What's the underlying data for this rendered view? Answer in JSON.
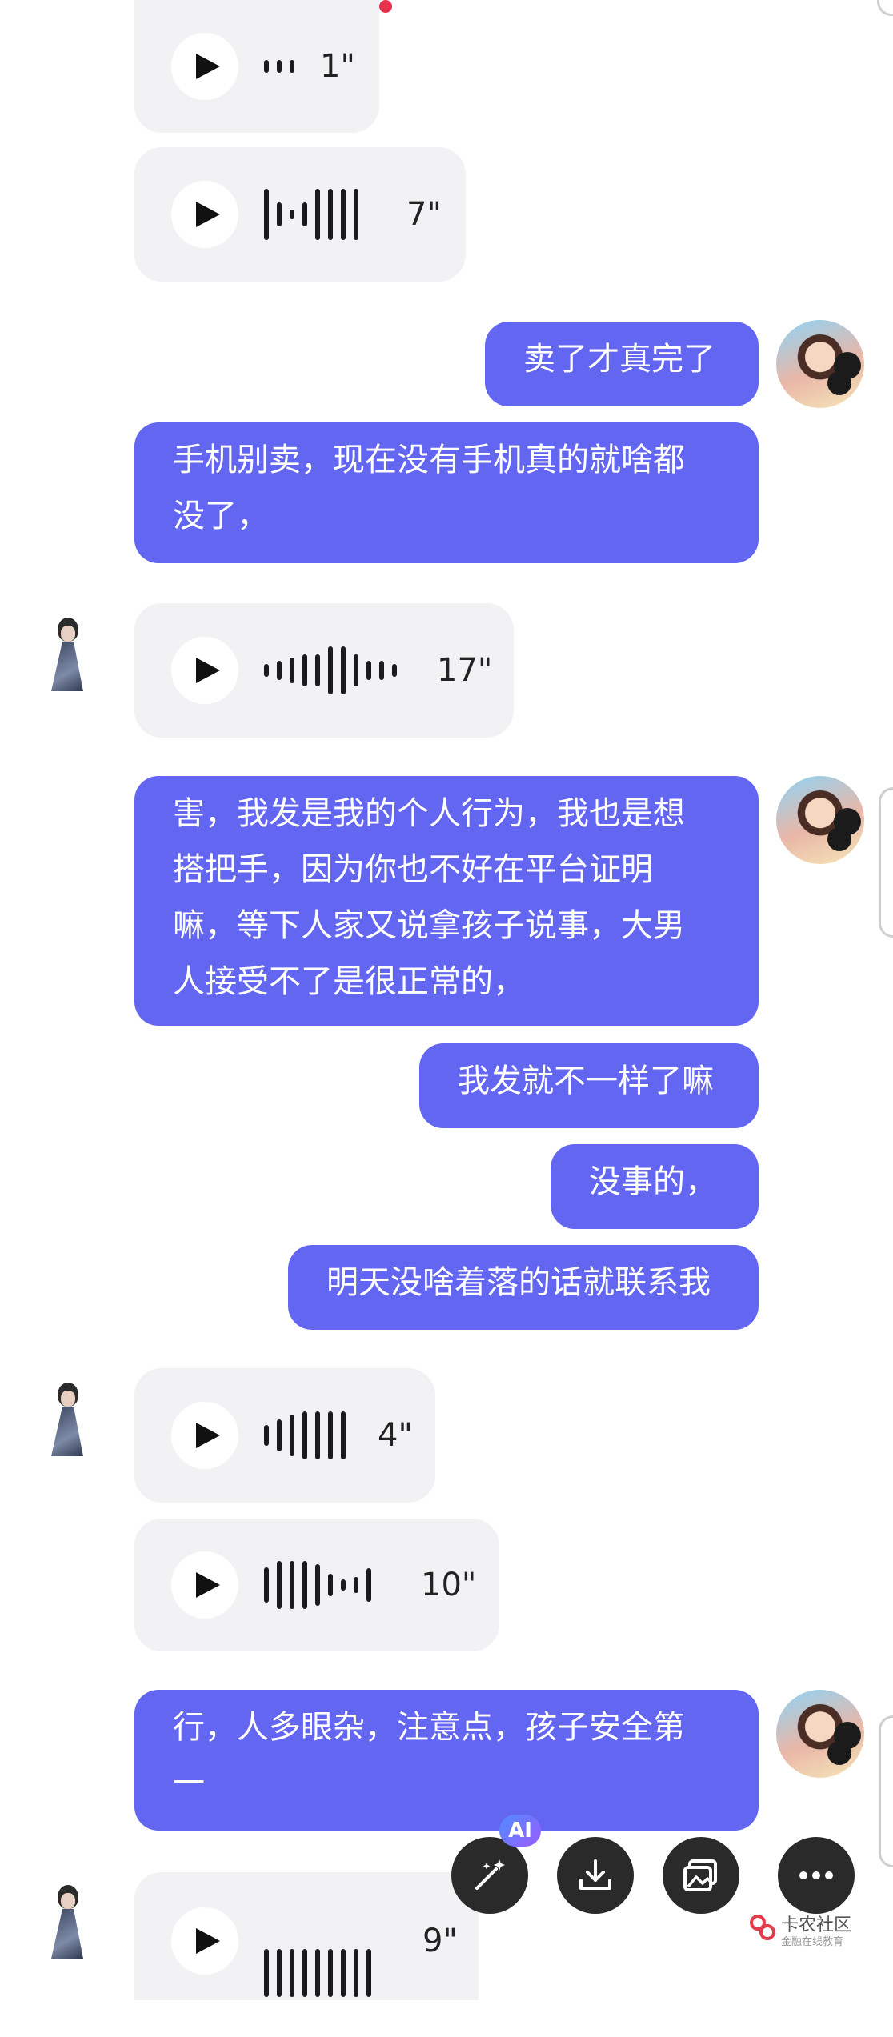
{
  "messages": {
    "voice_1": {
      "duration": "1\""
    },
    "voice_2": {
      "duration": "7\""
    },
    "sent_1": "卖了才真完了",
    "sent_2_line1": "手机别卖，现在没有手机真的就啥都",
    "sent_2_line2": "没了，",
    "voice_3": {
      "duration": "17\""
    },
    "sent_3_line1": "害，我发是我的个人行为，我也是想",
    "sent_3_line2": "搭把手，因为你也不好在平台证明",
    "sent_3_line3": "嘛，等下人家又说拿孩子说事，大男",
    "sent_3_line4": "人接受不了是很正常的，",
    "sent_4": "我发就不一样了嘛",
    "sent_5": "没事的，",
    "sent_6": "明天没啥着落的话就联系我",
    "voice_4": {
      "duration": "4\""
    },
    "voice_5": {
      "duration": "10\""
    },
    "sent_7_line1": "行，人多眼杂，注意点，孩子安全第",
    "sent_7_line2": "一",
    "voice_6": {
      "duration": "9\""
    }
  },
  "toolbar": {
    "ai_badge": "AI",
    "icons": [
      "magic-wand-icon",
      "download-icon",
      "image-icon",
      "more-icon"
    ]
  },
  "watermark": {
    "brand": "卡农社区",
    "tagline": "金融在线教育"
  },
  "colors": {
    "sent_bubble": "#6366f1",
    "voice_bubble": "#f2f2f4",
    "unread_dot": "#e8304a"
  }
}
